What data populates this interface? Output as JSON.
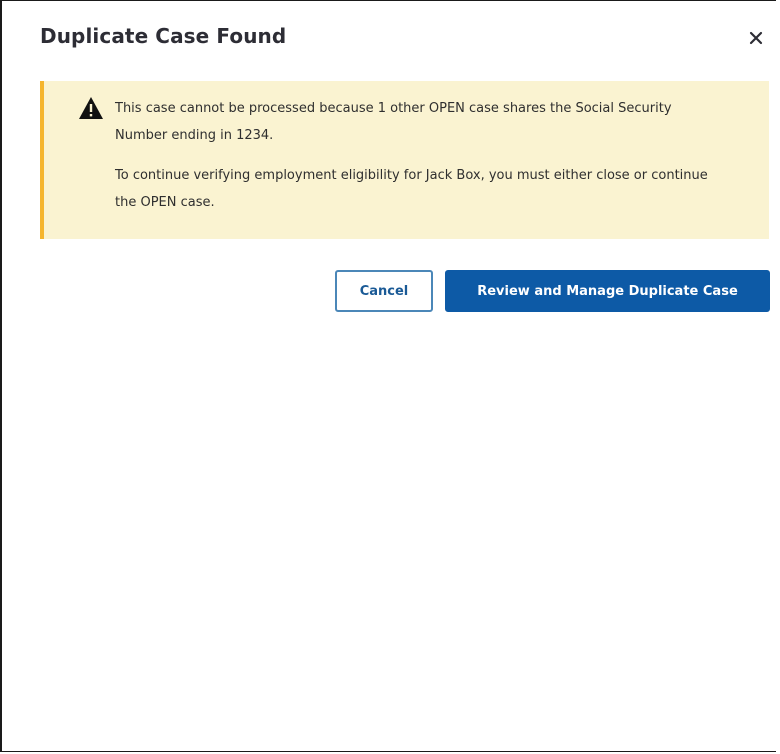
{
  "dialog": {
    "title": "Duplicate Case Found",
    "close_label": "×"
  },
  "alert": {
    "type": "warning",
    "icon": "warning-triangle-icon",
    "accent_color": "#f5b52e",
    "background_color": "#faf3d1",
    "message_1": "This case cannot be processed because 1 other OPEN case shares the Social Security Number ending in 1234.",
    "message_2": "To continue verifying employment eligibility for Jack Box, you must either close or continue the OPEN case."
  },
  "actions": {
    "cancel_label": "Cancel",
    "primary_label": "Review and Manage Duplicate Case",
    "primary_color": "#0d5aa6"
  }
}
